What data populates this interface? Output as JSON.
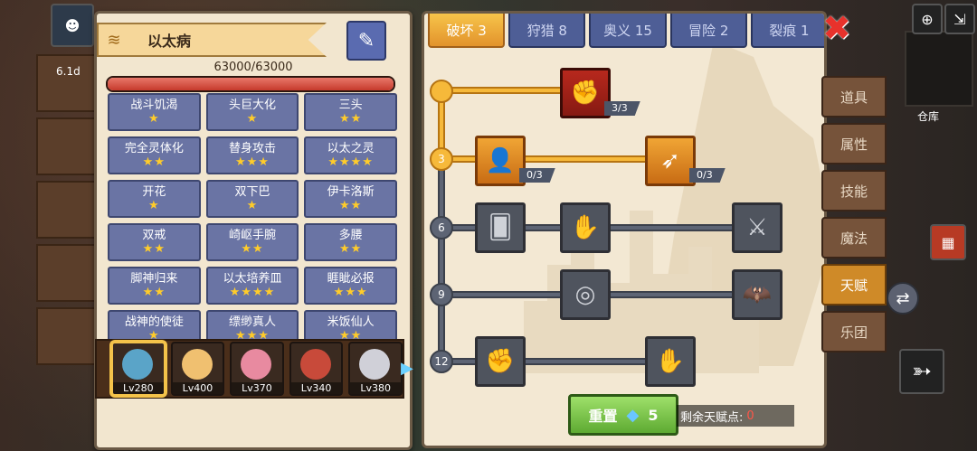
{
  "character": {
    "title": "以太病",
    "hp_text": "63000/63000",
    "hp_fraction": 1.0
  },
  "traits": [
    {
      "name": "战斗饥渴",
      "stars": 1
    },
    {
      "name": "头巨大化",
      "stars": 1
    },
    {
      "name": "三头",
      "stars": 2
    },
    {
      "name": "完全灵体化",
      "stars": 2
    },
    {
      "name": "替身攻击",
      "stars": 3
    },
    {
      "name": "以太之灵",
      "stars": 4
    },
    {
      "name": "开花",
      "stars": 1
    },
    {
      "name": "双下巴",
      "stars": 1
    },
    {
      "name": "伊卡洛斯",
      "stars": 2
    },
    {
      "name": "双戒",
      "stars": 2
    },
    {
      "name": "崎岖手腕",
      "stars": 2
    },
    {
      "name": "多腰",
      "stars": 2
    },
    {
      "name": "脚神归来",
      "stars": 2
    },
    {
      "name": "以太培养皿",
      "stars": 4
    },
    {
      "name": "睚眦必报",
      "stars": 3
    },
    {
      "name": "战神的使徒",
      "stars": 1
    },
    {
      "name": "缥缈真人",
      "stars": 3
    },
    {
      "name": "米饭仙人",
      "stars": 2
    }
  ],
  "heroes": [
    {
      "level": "Lv280",
      "color": "#5aa4c8",
      "selected": true
    },
    {
      "level": "Lv400",
      "color": "#f0c070",
      "selected": false
    },
    {
      "level": "Lv370",
      "color": "#e88aa0",
      "selected": false
    },
    {
      "level": "Lv340",
      "color": "#c84a3a",
      "selected": false
    },
    {
      "level": "Lv380",
      "color": "#d0d0d8",
      "selected": false
    }
  ],
  "tabs": [
    {
      "label": "破坏 3",
      "active": true
    },
    {
      "label": "狩猎 8",
      "active": false
    },
    {
      "label": "奥义 15",
      "active": false
    },
    {
      "label": "冒险 2",
      "active": false
    },
    {
      "label": "裂痕 1",
      "active": false
    }
  ],
  "tree": {
    "levels": [
      "3",
      "6",
      "9",
      "12"
    ],
    "nodes": [
      {
        "id": "arm-wrestle",
        "icon": "✊",
        "state": "red",
        "count": "3/3"
      },
      {
        "id": "body",
        "icon": "👤",
        "state": "gold",
        "count": "0/3"
      },
      {
        "id": "arrow",
        "icon": "➶",
        "state": "gold",
        "count": "0/3"
      },
      {
        "id": "cards",
        "icon": "🂠",
        "state": "locked"
      },
      {
        "id": "fist-bump",
        "icon": "✋",
        "state": "locked"
      },
      {
        "id": "sword-strike",
        "icon": "⚔",
        "state": "locked"
      },
      {
        "id": "ring-drop",
        "icon": "◎",
        "state": "locked"
      },
      {
        "id": "bat",
        "icon": "🦇",
        "state": "locked"
      },
      {
        "id": "fist",
        "icon": "✊",
        "state": "locked"
      },
      {
        "id": "gauntlet",
        "icon": "✋",
        "state": "locked"
      }
    ]
  },
  "reset": {
    "label": "重置",
    "cost": "5"
  },
  "points": {
    "label": "剩余天赋点:",
    "value": "0"
  },
  "side_menu": [
    {
      "label": "道具",
      "active": false
    },
    {
      "label": "属性",
      "active": false
    },
    {
      "label": "技能",
      "active": false
    },
    {
      "label": "魔法",
      "active": false
    },
    {
      "label": "天赋",
      "active": true
    },
    {
      "label": "乐团",
      "active": false
    }
  ],
  "hud": {
    "storage_label": "仓库",
    "time_label": "6.1d"
  }
}
